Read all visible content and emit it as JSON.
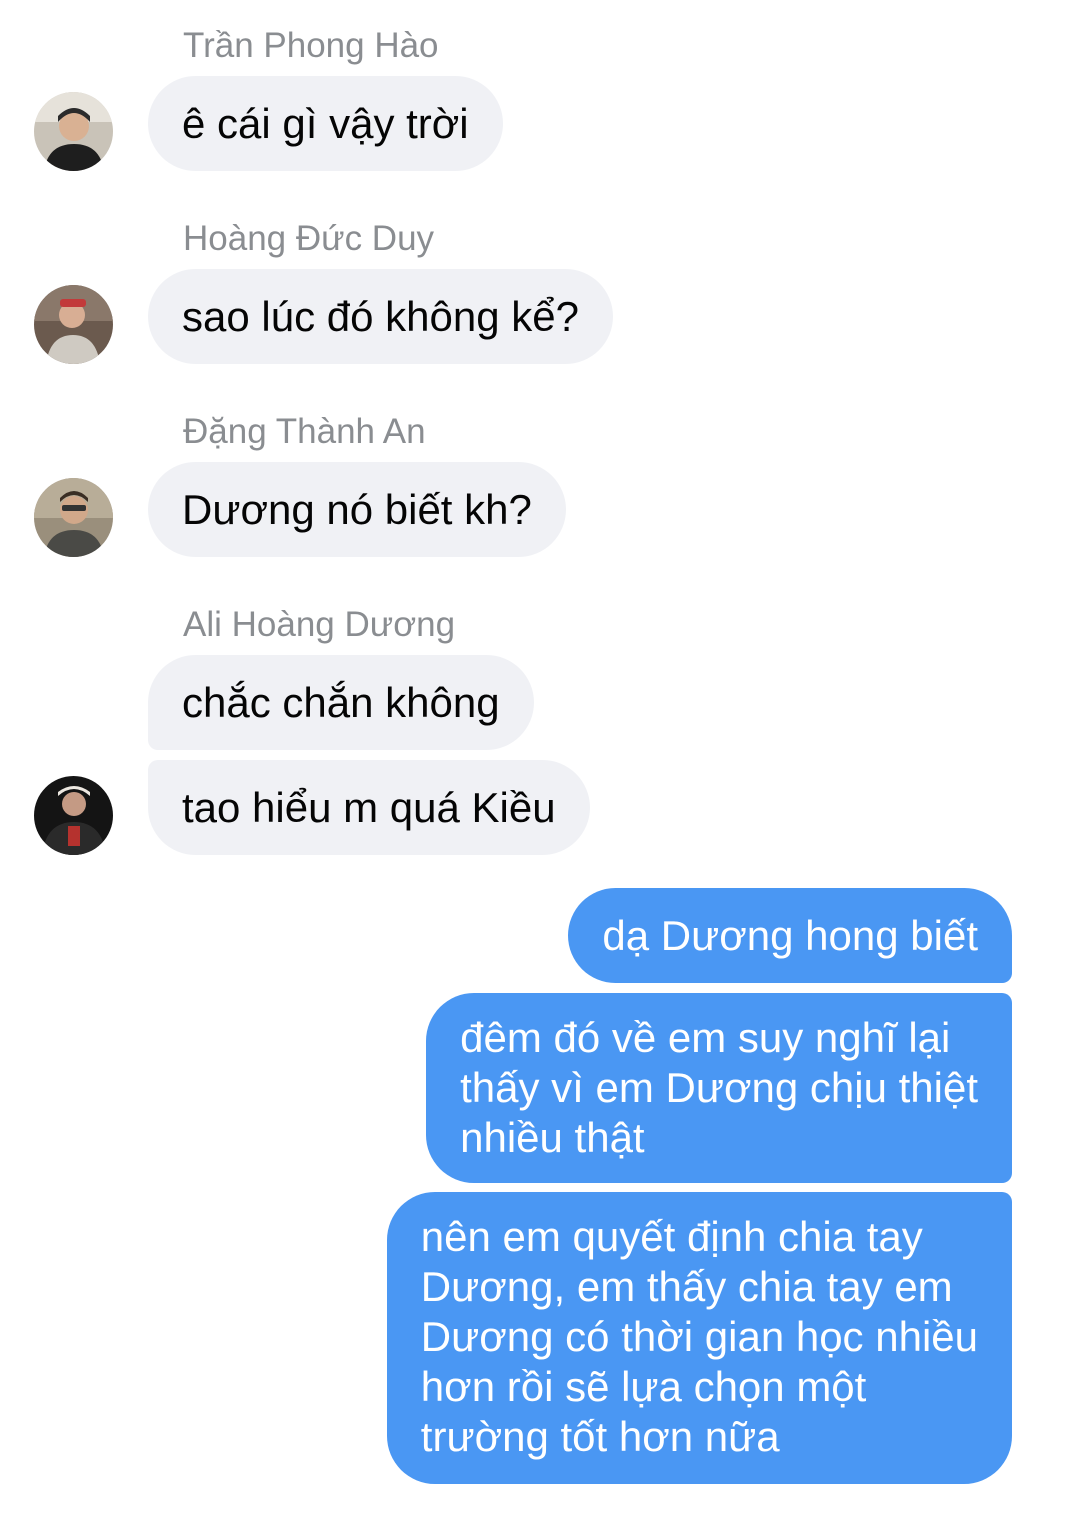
{
  "messages_in": [
    {
      "sender": "Trần Phong Hào",
      "text": "ê cái gì vậy trời",
      "avatar_icon": "user-avatar-icon"
    },
    {
      "sender": "Hoàng Đức Duy",
      "text": "sao lúc đó không kể?",
      "avatar_icon": "user-avatar-icon"
    },
    {
      "sender": "Đặng Thành An",
      "text": "Dương nó biết kh?",
      "avatar_icon": "user-avatar-icon"
    },
    {
      "sender": "Ali Hoàng Dương",
      "texts": [
        "chắc chắn không",
        "tao hiểu m quá Kiều"
      ],
      "avatar_icon": "user-avatar-icon"
    }
  ],
  "messages_out": [
    {
      "lines": [
        "dạ Dương hong biết"
      ]
    },
    {
      "lines": [
        "đêm đó về em suy nghĩ lại",
        "thấy vì em Dương chịu thiệt",
        "nhiều thật"
      ]
    },
    {
      "lines": [
        "nên em quyết định chia tay",
        "Dương, em thấy chia tay em",
        "Dương có thời gian học nhiều",
        "hơn rồi sẽ lựa chọn một",
        "trường tốt hơn nữa"
      ]
    }
  ],
  "colors": {
    "outgoing_bubble": "#4a97f3",
    "incoming_bubble": "#f0f1f5",
    "sender_name": "#8a8d91"
  }
}
